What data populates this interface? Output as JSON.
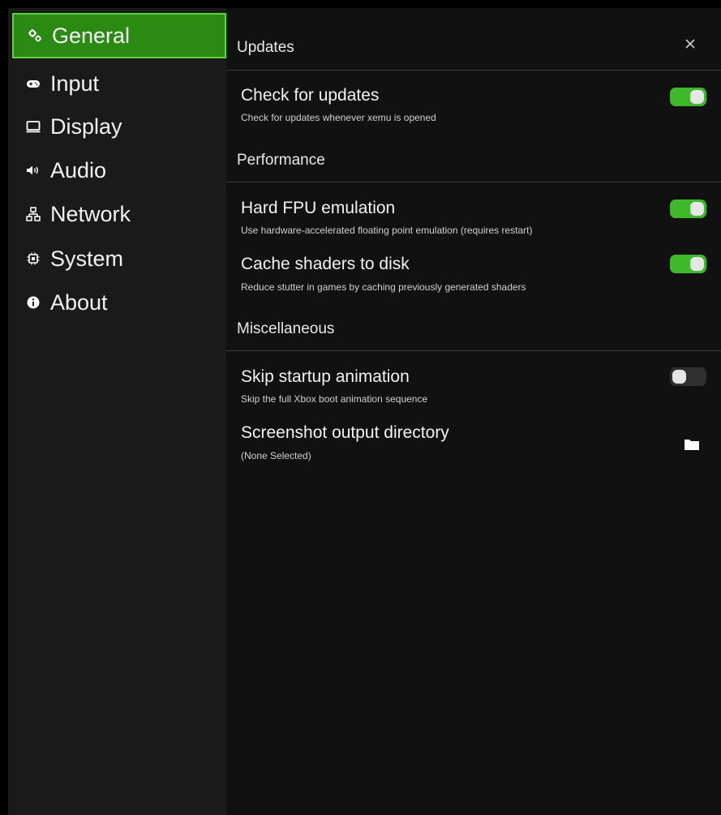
{
  "sidebar": {
    "items": [
      {
        "label": "General",
        "icon": "gears-icon",
        "active": true
      },
      {
        "label": "Input",
        "icon": "gamepad-icon",
        "active": false
      },
      {
        "label": "Display",
        "icon": "monitor-icon",
        "active": false
      },
      {
        "label": "Audio",
        "icon": "speaker-icon",
        "active": false
      },
      {
        "label": "Network",
        "icon": "network-icon",
        "active": false
      },
      {
        "label": "System",
        "icon": "chip-icon",
        "active": false
      },
      {
        "label": "About",
        "icon": "info-icon",
        "active": false
      }
    ]
  },
  "main": {
    "close_icon": "close-icon",
    "sections": [
      {
        "header": "Updates",
        "settings": [
          {
            "title": "Check for updates",
            "description": "Check for updates whenever xemu is opened",
            "control": "toggle",
            "enabled": true
          }
        ]
      },
      {
        "header": "Performance",
        "settings": [
          {
            "title": "Hard FPU emulation",
            "description": "Use hardware-accelerated floating point emulation (requires restart)",
            "control": "toggle",
            "enabled": true
          },
          {
            "title": "Cache shaders to disk",
            "description": "Reduce stutter in games by caching previously generated shaders",
            "control": "toggle",
            "enabled": true
          }
        ]
      },
      {
        "header": "Miscellaneous",
        "settings": [
          {
            "title": "Skip startup animation",
            "description": "Skip the full Xbox boot animation sequence",
            "control": "toggle",
            "enabled": false
          },
          {
            "title": "Screenshot output directory",
            "description": "(None Selected)",
            "control": "folder-picker",
            "icon": "folder-icon"
          }
        ]
      }
    ]
  },
  "colors": {
    "accent": "#2b8a12",
    "accent_border": "#5ed43b",
    "toggle_on": "#3fb82b",
    "toggle_off": "#2f2f2f",
    "sidebar_bg": "#1a1a1a",
    "panel_bg": "#111111"
  }
}
